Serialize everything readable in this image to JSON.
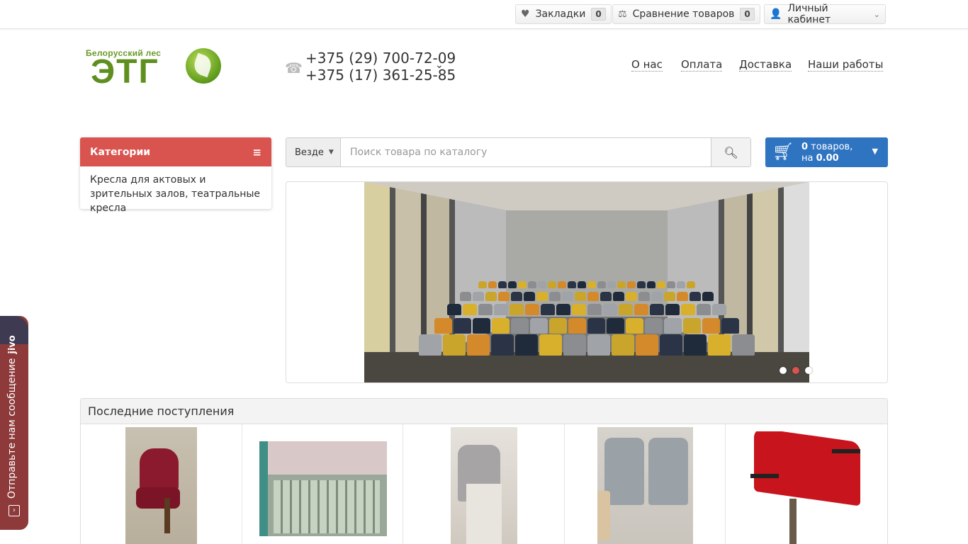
{
  "topbar": {
    "bookmarks": {
      "label": "Закладки",
      "count": "0"
    },
    "compare": {
      "label": "Сравнение товаров",
      "count": "0"
    },
    "account": {
      "label": "Личный кабинет"
    }
  },
  "logo": {
    "small_text": "Белорусский лес",
    "big_text": "ЭТГ"
  },
  "phones": [
    "+375 (29) 700-72-09",
    "+375 (17) 361-25-85"
  ],
  "nav": [
    "О нас",
    "Оплата",
    "Доставка",
    "Наши работы"
  ],
  "categories": {
    "title": "Категории",
    "items": [
      "Кресла для актовых и зрительных залов, театральные кресла"
    ]
  },
  "search": {
    "scope": "Везде",
    "placeholder": "Поиск товара по каталогу"
  },
  "cart": {
    "count": "0",
    "count_suffix": " товаров,",
    "sum_prefix": "на ",
    "sum": "0.00"
  },
  "slider": {
    "dots": 3,
    "active_dot": 1
  },
  "latest": {
    "title": "Последние поступления",
    "product_count": 5
  },
  "jivo": {
    "text": "Отправьте нам сообщение",
    "brand": "jivo"
  },
  "colors": {
    "accent_red": "#d9534f",
    "cart_blue": "#2f74c1",
    "logo_green": "#5e8f1f"
  },
  "icons": [
    "heart-icon",
    "scales-icon",
    "user-icon",
    "phone-icon",
    "menu-icon",
    "search-icon",
    "cart-icon",
    "chat-icon"
  ]
}
